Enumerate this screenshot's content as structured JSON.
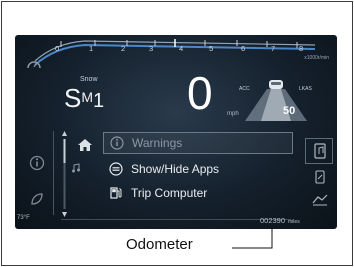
{
  "tachometer": {
    "ticks": [
      "0",
      "1",
      "2",
      "3",
      "4",
      "5",
      "6",
      "7",
      "8"
    ],
    "units": "x1000r/min"
  },
  "drive_mode": {
    "small_label": "Snow",
    "gear_letter": "S",
    "gear_mode": "M",
    "gear_number": "1"
  },
  "speed": {
    "value": "0",
    "unit": "mph"
  },
  "acc": {
    "left_label": "ACC",
    "right_label": "LKAS",
    "set_speed": "50"
  },
  "menu": {
    "items": [
      {
        "label": "Warnings",
        "icon": "info-icon",
        "highlighted": true
      },
      {
        "label": "Show/Hide Apps",
        "icon": "apps-icon",
        "highlighted": false
      },
      {
        "label": "Trip Computer",
        "icon": "fuel-pump-icon",
        "highlighted": false
      }
    ]
  },
  "outside_temp": "73°F",
  "odometer": {
    "value": "002390",
    "unit": "miles"
  },
  "callout": {
    "label": "Odometer"
  },
  "colors": {
    "screen_bg": "#14202c",
    "accent_arc": "#4a86c8",
    "menu_text": "#e8ecef"
  }
}
